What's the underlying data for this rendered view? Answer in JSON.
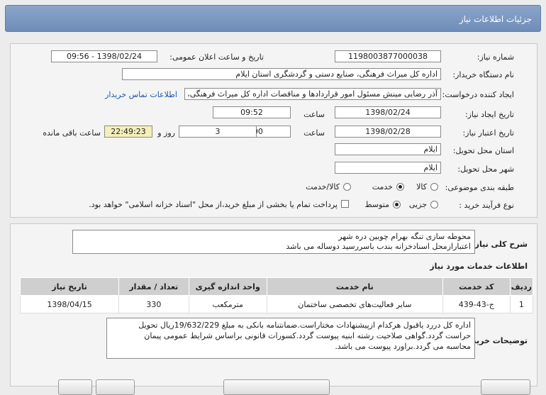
{
  "header": {
    "title": "جزئیات اطلاعات نیاز"
  },
  "form": {
    "need_number_label": "شماره نیاز:",
    "need_number": "1198003877000038",
    "announce_label": "تاریخ و ساعت اعلان عمومی:",
    "announce_value": "1398/02/24 - 09:56",
    "buyer_label": "نام دستگاه خریدار:",
    "buyer_value": "اداره کل میراث فرهنگی، صنایع دستی و گردشگری استان ایلام",
    "creator_label": "ایجاد کننده درخواست:",
    "creator_value": "آذر رضایی مینش مسئول امور قراردادها و مناقصات اداره کل میراث فرهنگی، صنایع",
    "contact_link": "اطلاعات تماس خریدار",
    "create_date_label": "تاریخ ایجاد نیاز:",
    "create_date": "1398/02/24",
    "time_label": "ساعت",
    "create_time": "09:52",
    "validity_label": "تاریخ اعتبار نیاز:",
    "validity_date": "1398/02/28",
    "validity_time": "09:00",
    "days_value": "3",
    "days_label": "روز و",
    "remaining_value": "22:49:23",
    "remaining_label": "ساعت باقی مانده",
    "province_label": "استان محل تحویل:",
    "province_value": "ایلام",
    "city_label": "شهر محل تحویل:",
    "city_value": "ایلام",
    "category_label": "طبقه بندی موضوعی:",
    "category_options": [
      "کالا",
      "خدمت",
      "کالا/خدمت"
    ],
    "category_selected": "خدمت",
    "process_label": "نوع فرآیند خرید :",
    "process_options": [
      "جزیی",
      "متوسط"
    ],
    "process_selected": "متوسط",
    "payment_note": "پرداخت تمام یا بخشی از مبلغ خرید،از محل \"اسناد خزانه اسلامی\" خواهد بود."
  },
  "description": {
    "label": "شرح کلی نیاز:",
    "text": "محوطه سازی تنگه بهرام چوبین دره شهر\nاعتبارازمحل اسنادخزانه بندب باسررسید دوساله می باشد"
  },
  "services": {
    "title": "اطلاعات خدمات مورد نیاز",
    "columns": [
      "ردیف",
      "کد خدمت",
      "نام خدمت",
      "واحد اندازه گیری",
      "تعداد / مقدار",
      "تاریخ نیاز"
    ],
    "rows": [
      [
        "1",
        "ج-43-439",
        "سایر فعالیت‌های تخصصی ساختمان",
        "مترمکعب",
        "330",
        "1398/04/15"
      ]
    ]
  },
  "notes": {
    "label": "توضیحات خریدار:",
    "text": "اداره کل دررد یاقبول هرکدام ازپیشنهادات مختاراست.ضمانتنامه بانکی به مبلغ 19/632/229ریال تحویل\nحراست گردد.گواهی صلاحیت رشته ابنیه پیوست گردد.کسورات قانونی براساس شرایط عمومی پیمان\nمحاسبه می گردد.براورد پیوست می باشد."
  },
  "colors": {
    "title_bar": "#7a96bf",
    "highlight_box": "#f5efb9",
    "link": "#1a56b0"
  }
}
